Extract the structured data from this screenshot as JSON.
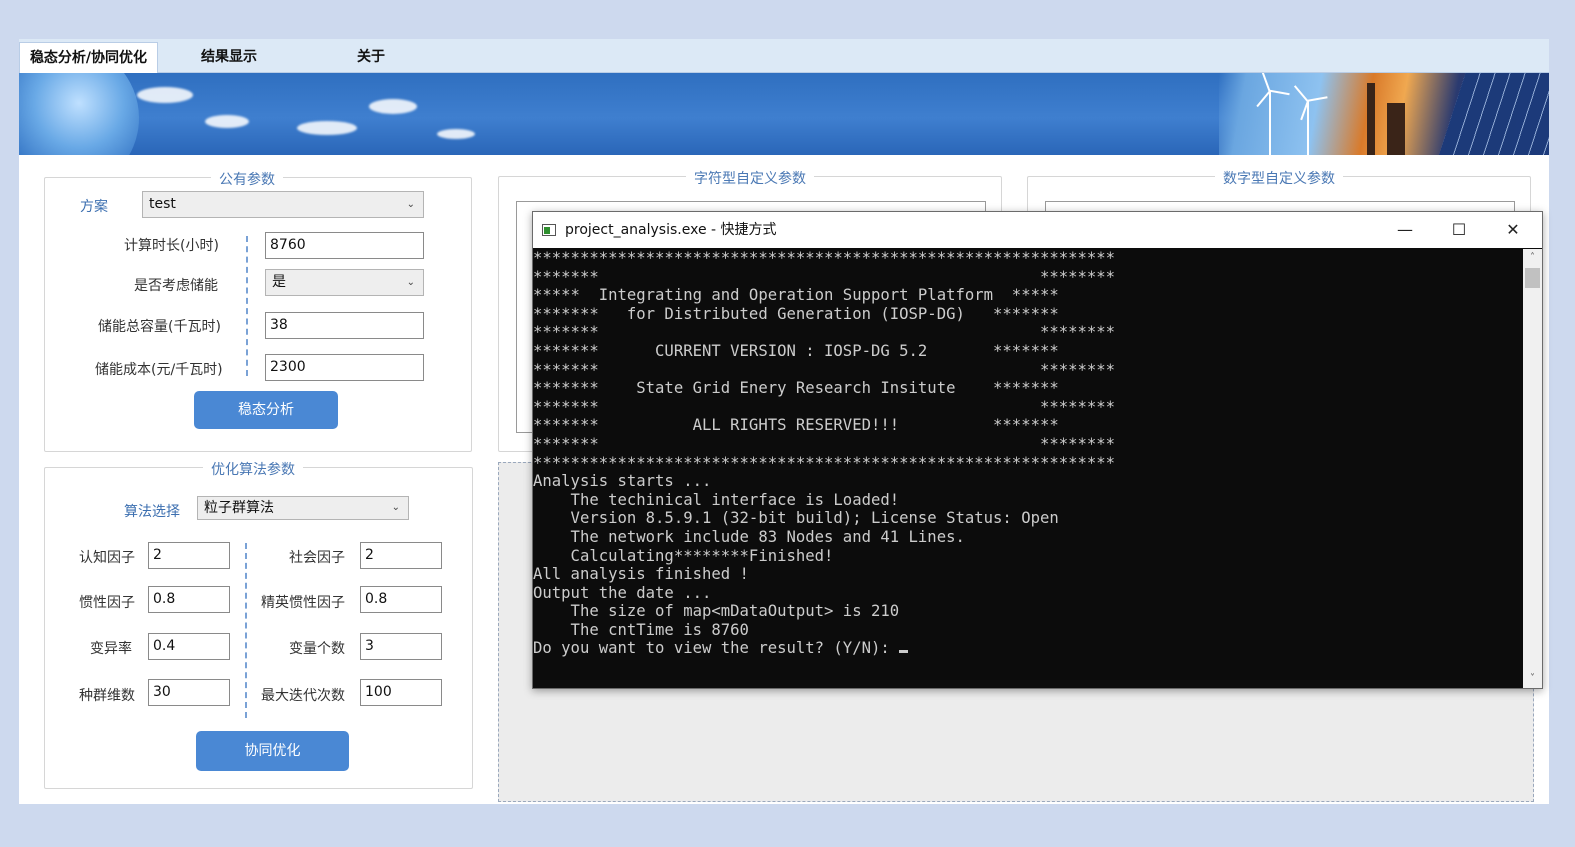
{
  "tabs": [
    {
      "label": "稳态分析/协同优化"
    },
    {
      "label": "结果显示"
    },
    {
      "label": "关于"
    }
  ],
  "public_params": {
    "title": "公有参数",
    "scheme_label": "方案",
    "scheme_value": "test",
    "duration_label": "计算时长(小时)",
    "duration_value": "8760",
    "storage_label": "是否考虑储能",
    "storage_value": "是",
    "capacity_label": "储能总容量(千瓦时)",
    "capacity_value": "38",
    "cost_label": "储能成本(元/千瓦时)",
    "cost_value": "2300",
    "analyze_button": "稳态分析"
  },
  "opt_params": {
    "title": "优化算法参数",
    "algo_label": "算法选择",
    "algo_value": "粒子群算法",
    "cognitive_label": "认知因子",
    "cognitive_value": "2",
    "social_label": "社会因子",
    "social_value": "2",
    "inertia_label": "惯性因子",
    "inertia_value": "0.8",
    "elite_inertia_label": "精英惯性因子",
    "elite_inertia_value": "0.8",
    "mutation_label": "变异率",
    "mutation_value": "0.4",
    "var_count_label": "变量个数",
    "var_count_value": "3",
    "pop_label": "种群维数",
    "pop_value": "30",
    "max_iter_label": "最大迭代次数",
    "max_iter_value": "100",
    "optimize_button": "协同优化"
  },
  "string_params": {
    "title": "字符型自定义参数"
  },
  "number_params": {
    "title": "数字型自定义参数"
  },
  "console": {
    "title": "project_analysis.exe - 快捷方式",
    "minimize": "—",
    "maximize": "☐",
    "close": "✕",
    "lines": [
      "**************************************************************",
      "*******                                               ********",
      "*****  Integrating and Operation Support Platform  *****",
      "*******   for Distributed Generation (IOSP-DG)   *******",
      "*******                                               ********",
      "*******      CURRENT VERSION : IOSP-DG 5.2       *******",
      "*******                                               ********",
      "*******    State Grid Enery Research Insitute    *******",
      "*******                                               ********",
      "*******          ALL RIGHTS RESERVED!!!          *******",
      "*******                                               ********",
      "**************************************************************",
      "",
      "Analysis starts ...",
      "    The techinical interface is Loaded!",
      "    Version 8.5.9.1 (32-bit build); License Status: Open",
      "    The network include 83 Nodes and 41 Lines.",
      "    Calculating********Finished!",
      "All analysis finished !",
      "Output the date ...",
      "    The size of map<mDataOutput> is 210",
      "    The cntTime is 8760",
      "Do you want to view the result? (Y/N): "
    ]
  }
}
